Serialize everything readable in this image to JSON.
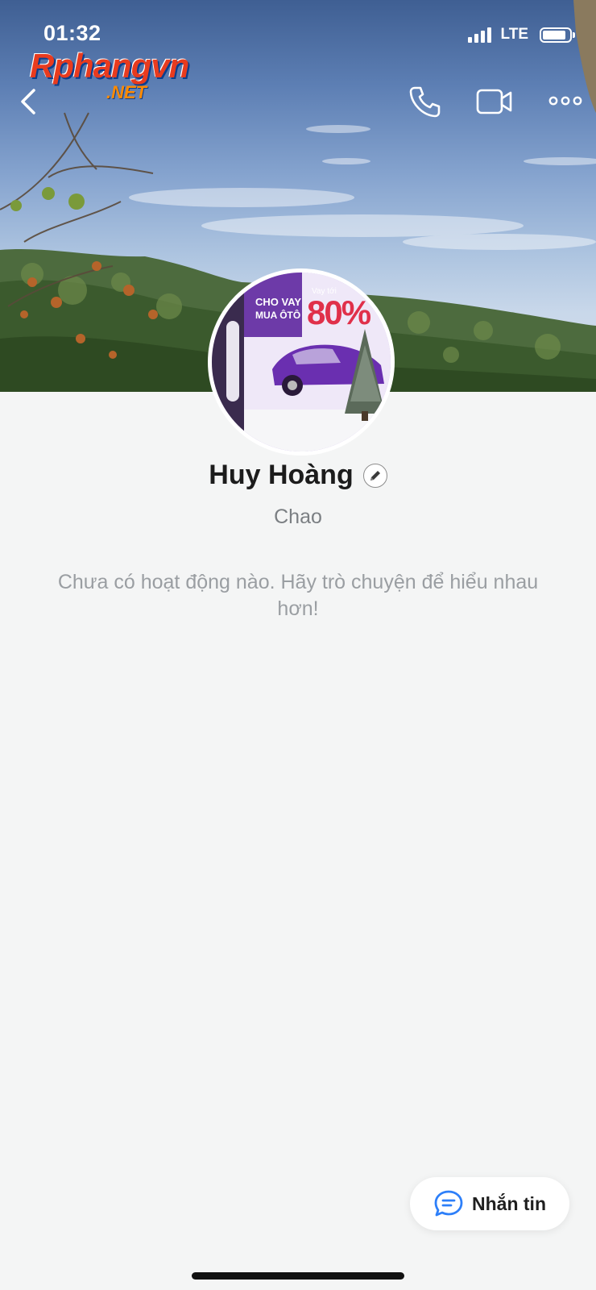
{
  "status_bar": {
    "time": "01:32",
    "network": "LTE",
    "icons": [
      "signal-icon",
      "battery-icon"
    ]
  },
  "watermark": {
    "main": "Rphangvn",
    "sub": ".NET"
  },
  "header": {
    "icons": [
      "back-chevron-icon",
      "phone-icon",
      "video-camera-icon",
      "more-icon"
    ]
  },
  "avatar": {
    "line1": "CHO VAY",
    "line2": "MUA ÔTÔ",
    "promo_small": "Vay tới",
    "promo_big": "80%"
  },
  "profile": {
    "name": "Huy Hoàng",
    "status": "Chao",
    "empty_message": "Chưa có hoạt động nào. Hãy trò chuyện để hiểu nhau hơn!"
  },
  "actions": {
    "message_label": "Nhắn tin",
    "message_icon": "chat-bubble-icon"
  },
  "colors": {
    "background": "#f4f5f5",
    "accent": "#2d7ff9",
    "text_primary": "#1c1c1c",
    "text_secondary": "#7b7f83"
  }
}
